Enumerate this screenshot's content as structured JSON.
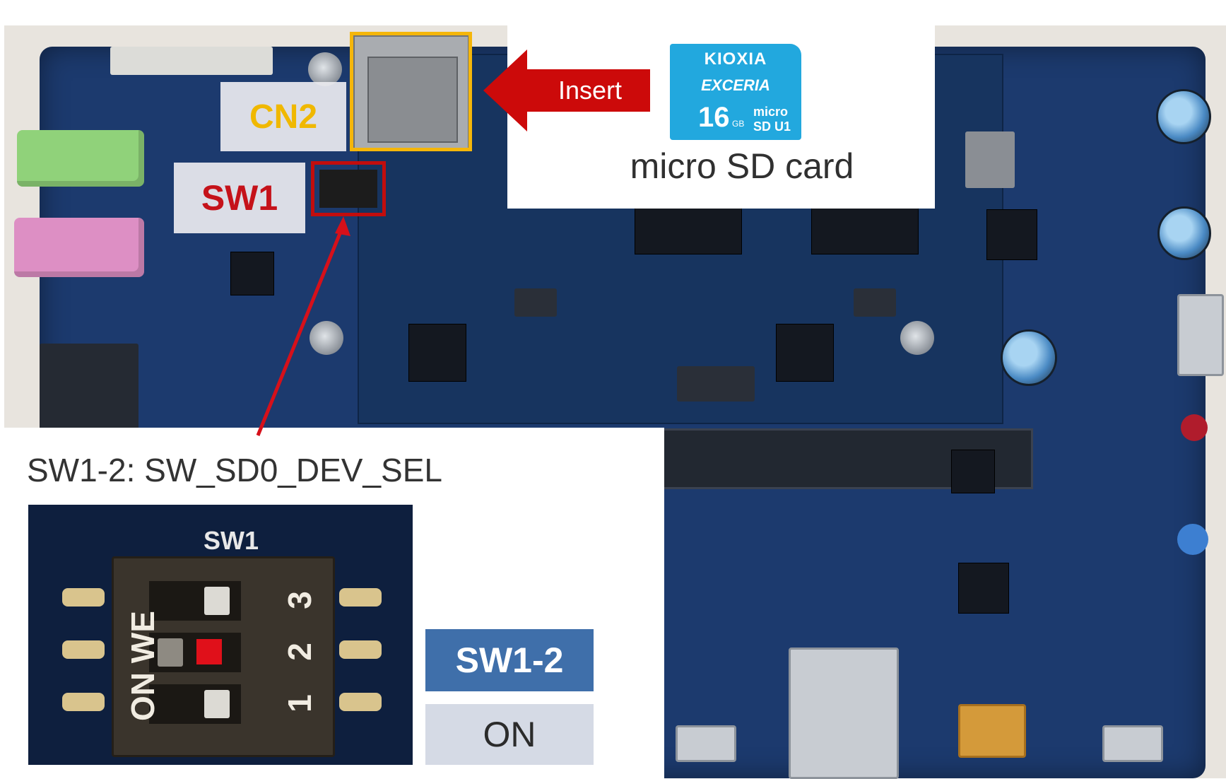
{
  "labels": {
    "cn2": "CN2",
    "sw1": "SW1",
    "insert": "Insert",
    "sd_caption": "micro SD card"
  },
  "sd_card": {
    "brand": "KIOXIA",
    "series": "EXCERIA",
    "capacity": "16",
    "capacity_unit": "GB",
    "logo": "micro SD U1"
  },
  "switch_detail": {
    "title": "SW1-2: SW_SD0_DEV_SEL",
    "silkscreen": "SW1",
    "switch_text": "ON WE",
    "position_numbers": [
      "1",
      "2",
      "3"
    ],
    "table_header": "SW1-2",
    "table_value": "ON"
  },
  "colors": {
    "cn2_highlight": "#f5b60a",
    "sw1_highlight": "#c20d0d",
    "arrow": "#cc0a0a",
    "pcb": "#1c3a6e",
    "table_header_bg": "#3f6faa",
    "table_cell_bg": "#d5dae5"
  }
}
